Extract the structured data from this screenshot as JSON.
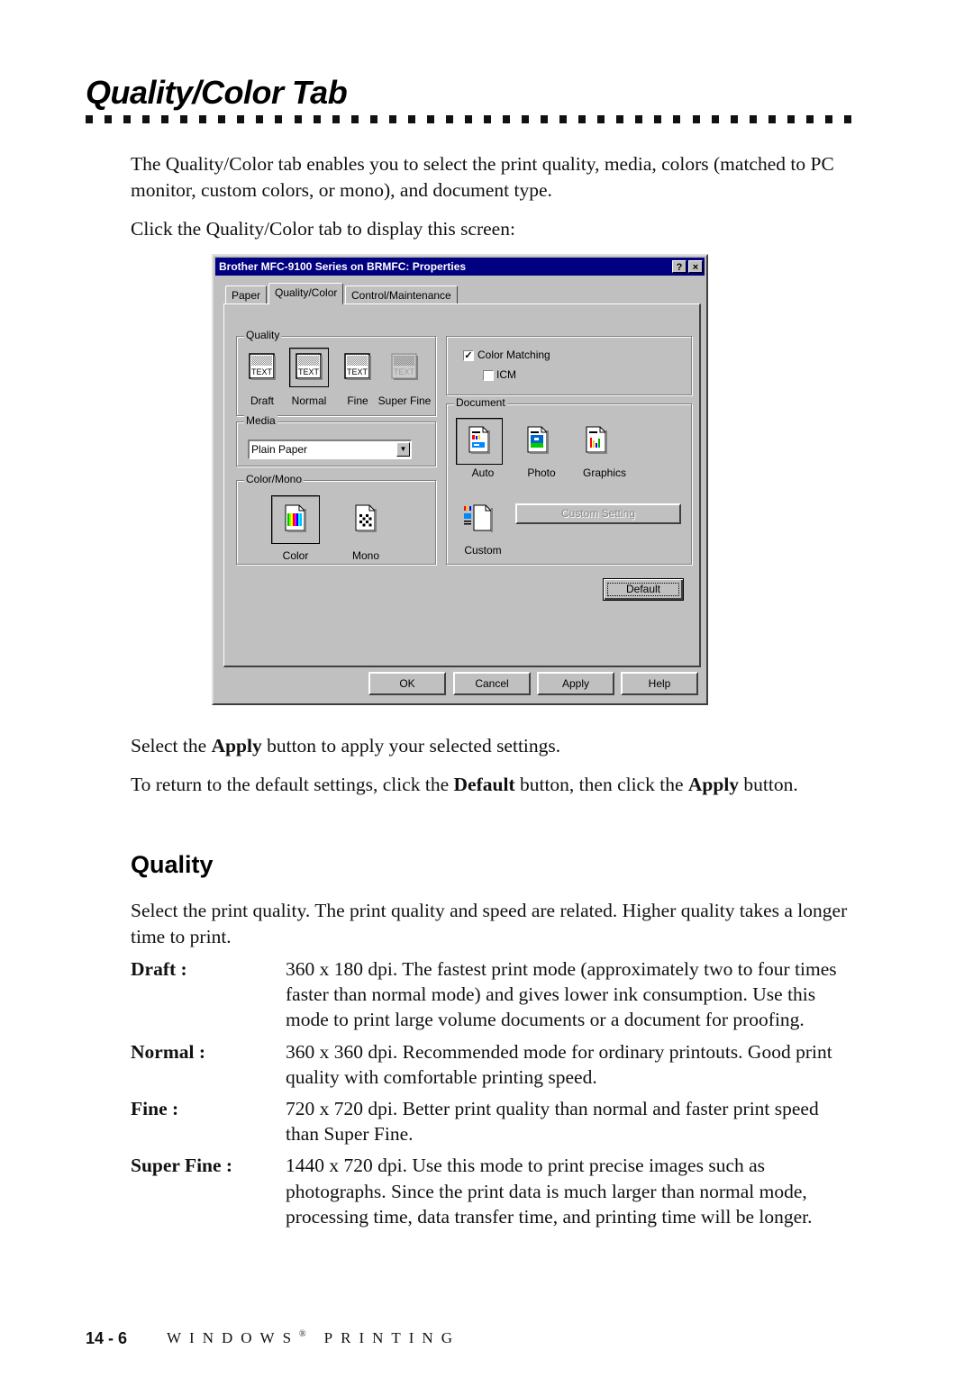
{
  "page": {
    "title": "Quality/Color Tab",
    "intro": "The Quality/Color tab enables you to select the print quality, media, colors (matched to PC monitor, custom colors, or mono), and document type.",
    "click_instruction": "Click the Quality/Color tab to display this screen:",
    "apply_para": {
      "pre": "Select the ",
      "bold": "Apply",
      "post": " button to apply your selected settings."
    },
    "default_para": {
      "pre": "To return to the default settings, click the ",
      "bold1": "Default",
      "mid": " button, then click the ",
      "bold2": "Apply",
      "post": " button."
    },
    "quality_heading": "Quality",
    "quality_intro": "Select the print quality. The print quality and speed are related. Higher quality takes a longer time to print.",
    "quality_modes": [
      {
        "term": "Draft :",
        "desc": "360 x 180 dpi. The fastest print mode (approximately two to four times faster than normal mode) and gives lower ink consumption. Use this mode to print large volume documents or a document for proofing."
      },
      {
        "term": "Normal :",
        "desc": "360 x 360 dpi. Recommended mode for ordinary printouts. Good print quality with comfortable printing speed."
      },
      {
        "term": "Fine :",
        "desc": "720 x 720 dpi. Better print quality than normal and faster print speed than Super Fine."
      },
      {
        "term": "Super Fine :",
        "desc": "1440 x 720 dpi. Use this mode to print precise images such as photographs. Since the print data is much larger than normal mode, processing time, data transfer time, and printing time will be longer."
      }
    ],
    "footer": {
      "page_number": "14 - 6",
      "section_pre": "WINDOWS",
      "section_mark": "®",
      "section_post": "PRINTING"
    }
  },
  "dialog": {
    "title": "Brother MFC-9100 Series on BRMFC: Properties",
    "help_button": "?",
    "close_button": "×",
    "tabs": [
      {
        "label": "Paper",
        "active": false
      },
      {
        "label": "Quality/Color",
        "active": true
      },
      {
        "label": "Control/Maintenance",
        "active": false
      }
    ],
    "quality": {
      "group_label": "Quality",
      "options": [
        {
          "label": "Draft",
          "selected": false,
          "enabled": true,
          "icon": "text-sample-icon"
        },
        {
          "label": "Normal",
          "selected": true,
          "enabled": true,
          "icon": "text-sample-icon"
        },
        {
          "label": "Fine",
          "selected": false,
          "enabled": true,
          "icon": "text-sample-icon"
        },
        {
          "label": "Super Fine",
          "selected": false,
          "enabled": false,
          "icon": "text-sample-icon"
        }
      ],
      "icon_text": "TEXT"
    },
    "media": {
      "group_label": "Media",
      "selected": "Plain Paper"
    },
    "color_mono": {
      "group_label": "Color/Mono",
      "options": [
        {
          "label": "Color",
          "selected": true,
          "icon": "color-page-icon"
        },
        {
          "label": "Mono",
          "selected": false,
          "icon": "mono-page-icon"
        }
      ]
    },
    "color_matching": {
      "label": "Color Matching",
      "checked": true
    },
    "icm": {
      "label": "ICM",
      "checked": false
    },
    "document": {
      "group_label": "Document",
      "options": [
        {
          "label": "Auto",
          "selected": true,
          "icon": "auto-document-icon"
        },
        {
          "label": "Photo",
          "selected": false,
          "icon": "photo-document-icon"
        },
        {
          "label": "Graphics",
          "selected": false,
          "icon": "graphics-document-icon"
        },
        {
          "label": "Custom",
          "selected": false,
          "icon": "custom-document-icon"
        }
      ],
      "custom_setting_button": "Custom Setting"
    },
    "default_button": "Default",
    "buttons": {
      "ok": "OK",
      "cancel": "Cancel",
      "apply": "Apply",
      "help": "Help"
    },
    "colors": {
      "titlebar": "#000080",
      "face": "#c0c0c0"
    }
  }
}
